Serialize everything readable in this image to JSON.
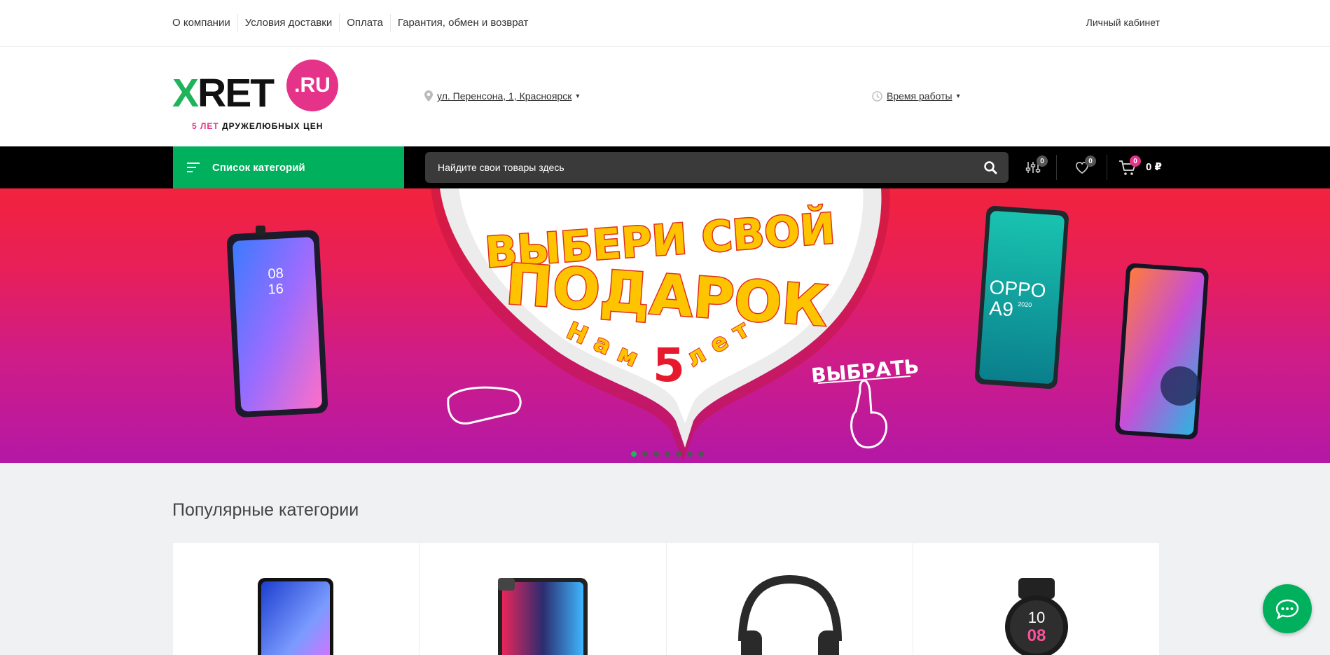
{
  "topnav": {
    "items": [
      {
        "label": "О компании"
      },
      {
        "label": "Условия доставки"
      },
      {
        "label": "Оплата"
      },
      {
        "label": "Гарантия, обмен и возврат"
      }
    ],
    "account": "Личный кабинет"
  },
  "header": {
    "logo": {
      "x_letter": "X",
      "brand": "RET",
      "domain": ".RU",
      "tag_pink": "5 ЛЕТ",
      "tag_dark": "ДРУЖЕЛЮБНЫХ ЦЕН"
    },
    "address": "ул. Перенсона, 1, Красноярск",
    "hours": "Время работы"
  },
  "navbar": {
    "categories_label": "Список категорий",
    "search_placeholder": "Найдите свои товары здесь",
    "compare_count": "0",
    "favorites_count": "0",
    "cart_count": "0",
    "cart_sum": "0 ₽"
  },
  "banner": {
    "headline1": "ВЫБЕРИ СВОЙ",
    "headline2": "ПОДАРОК",
    "sub_left": "Нам",
    "sub_num": "5",
    "sub_right": "лет",
    "cta": "ВЫБРАТЬ",
    "phone_time_h": "08",
    "phone_time_m": "16",
    "phone_brand": "OPPO",
    "phone_model": "A9",
    "phone_year": "2020",
    "slides_total": 7,
    "active_slide": 1
  },
  "popular": {
    "title": "Популярные категории",
    "watch_h": "10",
    "watch_m": "08"
  },
  "colors": {
    "green": "#00b05c",
    "pink": "#e6338a",
    "banner_top": "#f2233d",
    "banner_bottom": "#b418a6"
  }
}
